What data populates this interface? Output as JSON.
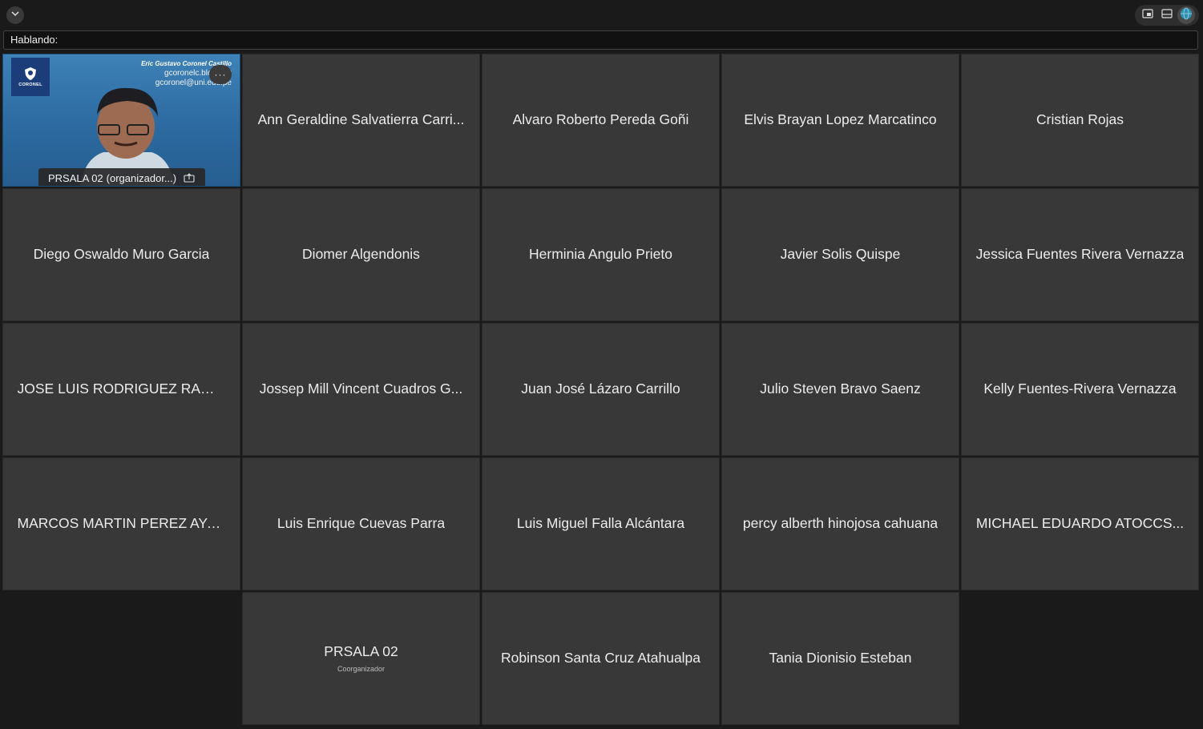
{
  "toolbar": {
    "collapse_icon": "chevron-down-icon",
    "view_controls": [
      "picture-in-picture-icon",
      "gallery-view-icon",
      "globe-icon"
    ]
  },
  "speaking": {
    "label": "Hablando:"
  },
  "video_tile": {
    "name": "PRSALA 02",
    "role": "(organizador...)",
    "overlay_title": "Eric Gustavo Coronel Castillo",
    "overlay_line1": "gcoronelc.blogspot",
    "overlay_line2": "gcoronel@uni.edu.pe",
    "logo_text": "CORONEL",
    "more_label": "···"
  },
  "participants": [
    {
      "name": "Ann Geraldine Salvatierra Carri..."
    },
    {
      "name": "Alvaro Roberto Pereda Goñi"
    },
    {
      "name": "Elvis Brayan Lopez Marcatinco"
    },
    {
      "name": "Cristian Rojas"
    },
    {
      "name": "Diego Oswaldo Muro Garcia"
    },
    {
      "name": "Diomer Algendonis"
    },
    {
      "name": "Herminia Angulo Prieto"
    },
    {
      "name": "Javier Solis Quispe"
    },
    {
      "name": "Jessica Fuentes Rivera Vernazza"
    },
    {
      "name": "JOSE LUIS RODRIGUEZ RAMI..."
    },
    {
      "name": "Jossep Mill Vincent Cuadros G..."
    },
    {
      "name": "Juan José Lázaro Carrillo"
    },
    {
      "name": "Julio Steven Bravo Saenz"
    },
    {
      "name": "Kelly Fuentes-Rivera Vernazza"
    },
    {
      "name": "MARCOS MARTIN PEREZ AYA..."
    },
    {
      "name": "Luis Enrique Cuevas Parra"
    },
    {
      "name": "Luis Miguel Falla Alcántara"
    },
    {
      "name": "percy alberth hinojosa cahuana"
    },
    {
      "name": "MICHAEL EDUARDO ATOCCS..."
    },
    {
      "name": "PRSALA 02",
      "role": "Coorganizador"
    },
    {
      "name": "Robinson Santa Cruz Atahualpa"
    },
    {
      "name": "Tania Dionisio Esteban"
    }
  ],
  "colors": {
    "background": "#1a1a1a",
    "tile": "#383838",
    "video_blue": "#2e6fa5"
  }
}
